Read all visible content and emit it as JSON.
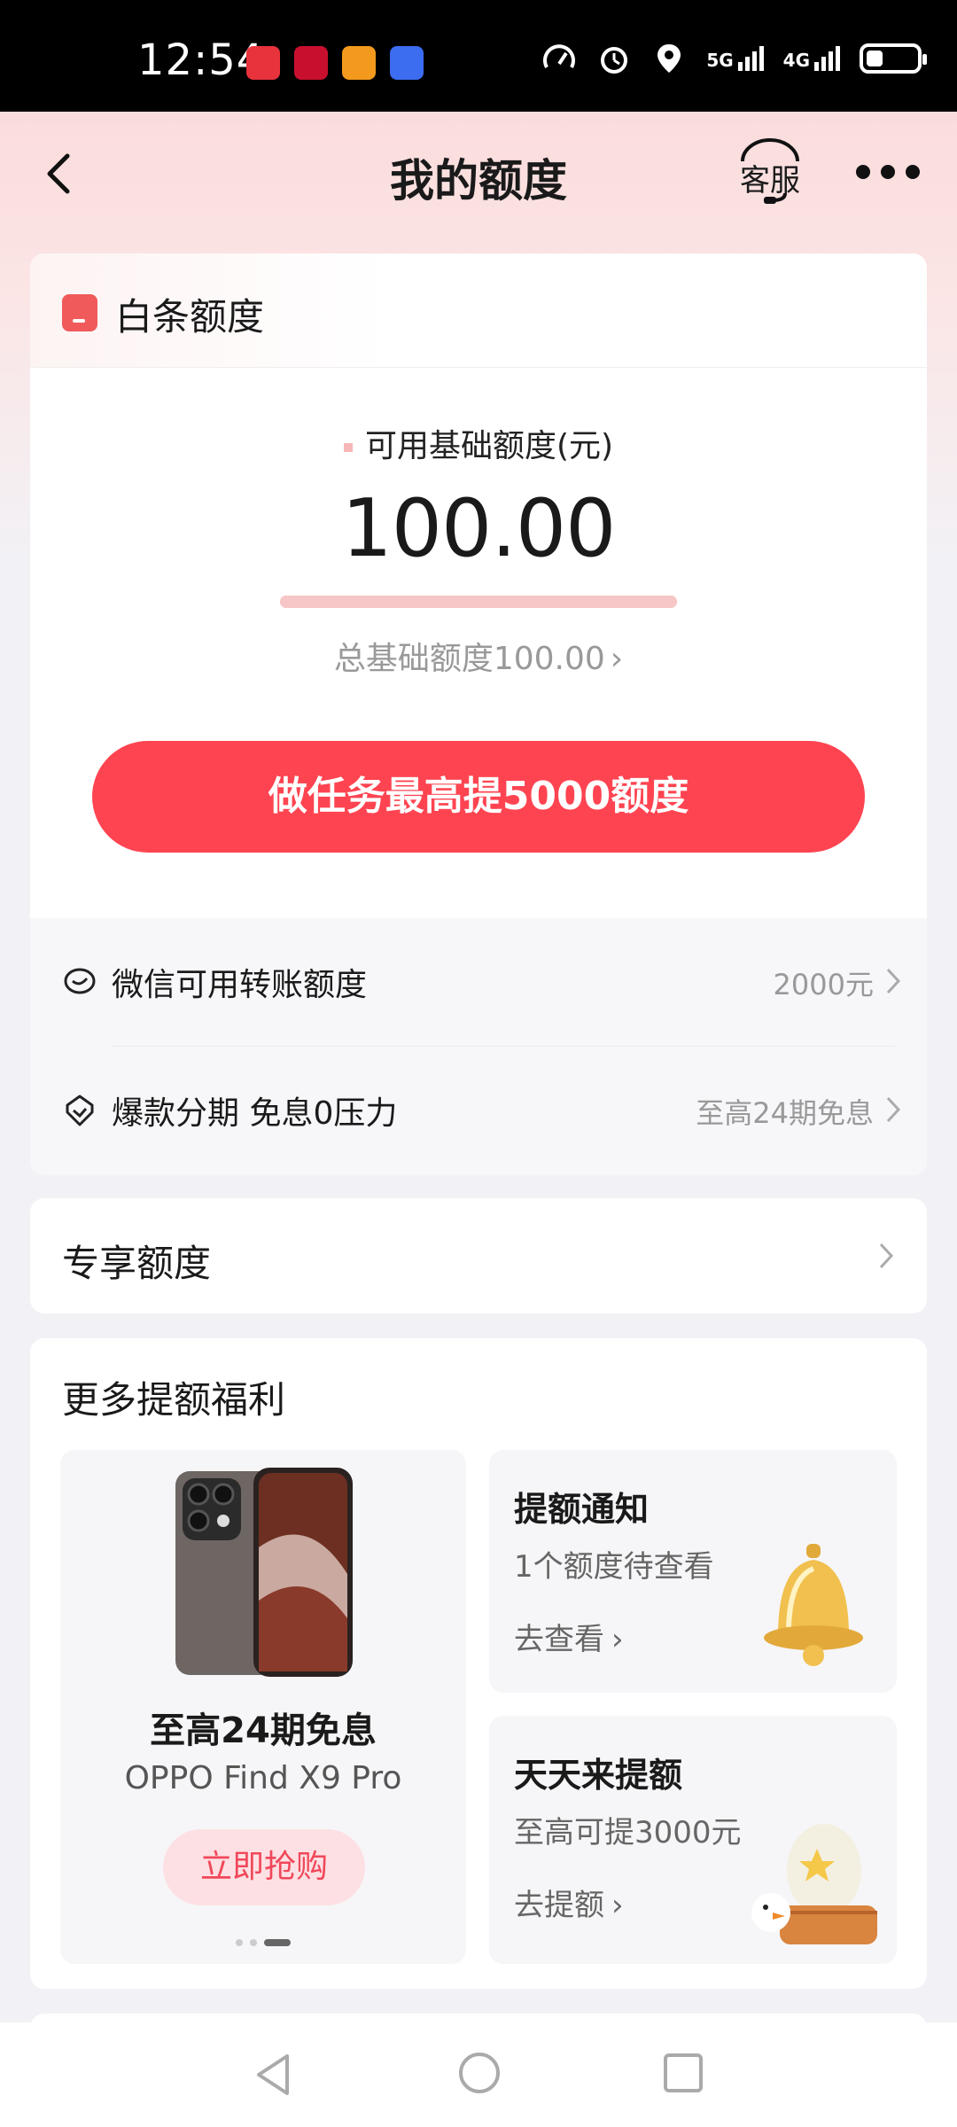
{
  "status_bar": {
    "time": "12:54",
    "network_1": "5G",
    "network_2": "4G",
    "icons": [
      "huawei-app-icon",
      "game-app-icon",
      "gift-app-icon",
      "music-app-icon",
      "speedometer-icon",
      "alarm-icon",
      "location-icon",
      "signal-5g-icon",
      "signal-4g-icon",
      "battery-icon"
    ]
  },
  "header": {
    "title": "我的额度",
    "service_label": "客服"
  },
  "baitiao": {
    "title": "白条额度",
    "available_label": "可用基础额度(元)",
    "available_amount": "100.00",
    "available_ratio": 1.0,
    "total_text": "总基础额度100.00",
    "cta_label": "做任务最高提5000额度"
  },
  "rows": [
    {
      "label": "微信可用转账额度",
      "value": "2000元"
    },
    {
      "label": "爆款分期 免息0压力",
      "value": "至高24期免息"
    }
  ],
  "exclusive": {
    "title": "专享额度"
  },
  "more_benefits": {
    "title": "更多提额福利",
    "promo": {
      "title": "至高24期免息",
      "subtitle": "OPPO Find X9 Pro",
      "button_label": "立即抢购"
    },
    "cards": [
      {
        "title": "提额通知",
        "subtitle": "1个额度待查看",
        "link": "去查看"
      },
      {
        "title": "天天来提额",
        "subtitle": "至高可提3000元",
        "link": "去提额"
      }
    ]
  },
  "colors": {
    "accent": "#ff4451",
    "hero_gradient_top": "#fbdcdc",
    "page_bg": "#f2f2f6",
    "promo_button_bg": "#fde0e3",
    "promo_button_text": "#f0485a"
  }
}
